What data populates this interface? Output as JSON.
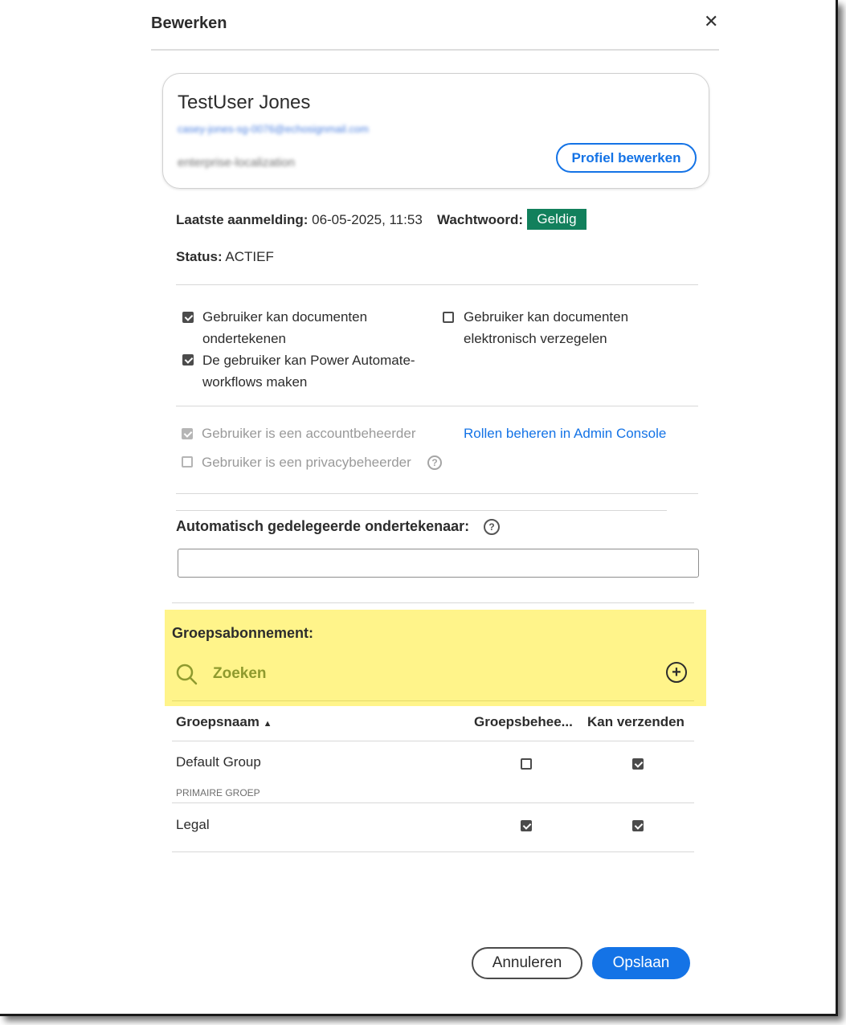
{
  "dialog": {
    "title": "Bewerken",
    "close_icon": "close-icon"
  },
  "profile": {
    "name": "TestUser Jones",
    "email": "casey-jones-sg-0076@echosignmail.com",
    "organization": "enterprise-localization",
    "edit_button": "Profiel bewerken"
  },
  "meta": {
    "last_login_label": "Laatste aanmelding:",
    "last_login_value": "06-05-2025, 11:53",
    "password_label": "Wachtwoord:",
    "password_badge": "Geldig",
    "password_badge_color": "#12805c",
    "status_label": "Status:",
    "status_value": "ACTIEF"
  },
  "permissions": [
    {
      "label_line1": "Gebruiker kan documenten",
      "label_line2": "ondertekenen",
      "checked": true
    },
    {
      "label_line1": "De gebruiker kan Power Automate-",
      "label_line2": "workflows maken",
      "checked": true
    },
    {
      "label_line1": "Gebruiker kan documenten",
      "label_line2": "elektronisch verzegelen",
      "checked": false
    }
  ],
  "admin_roles": {
    "account_admin": {
      "label": "Gebruiker is een accountbeheerder",
      "checked": true,
      "disabled": true
    },
    "privacy_admin": {
      "label": "Gebruiker is een privacybeheerder",
      "checked": false,
      "disabled": true
    },
    "manage_link": "Rollen beheren in Admin Console",
    "help_icon": "question-circle-icon"
  },
  "delegate": {
    "label": "Automatisch gedelegeerde ondertekenaar:",
    "value": "",
    "help_icon": "question-circle-icon"
  },
  "group_subscription": {
    "label": "Groepsabonnement:",
    "search_placeholder": "Zoeken",
    "search_icon": "search-icon",
    "add_icon": "plus-circle-icon",
    "highlight_color": "#fff48a"
  },
  "groups_table": {
    "columns": [
      "Groepsnaam",
      "Groepsbehee...",
      "Kan verzenden"
    ],
    "sort_indicator": "▲",
    "rows": [
      {
        "name": "Default Group",
        "sublabel": "PRIMAIRE GROEP",
        "group_admin": false,
        "can_send": true
      },
      {
        "name": "Legal",
        "sublabel": "",
        "group_admin": true,
        "can_send": true
      }
    ]
  },
  "footer": {
    "cancel": "Annuleren",
    "save": "Opslaan",
    "accent": "#1473e6"
  }
}
